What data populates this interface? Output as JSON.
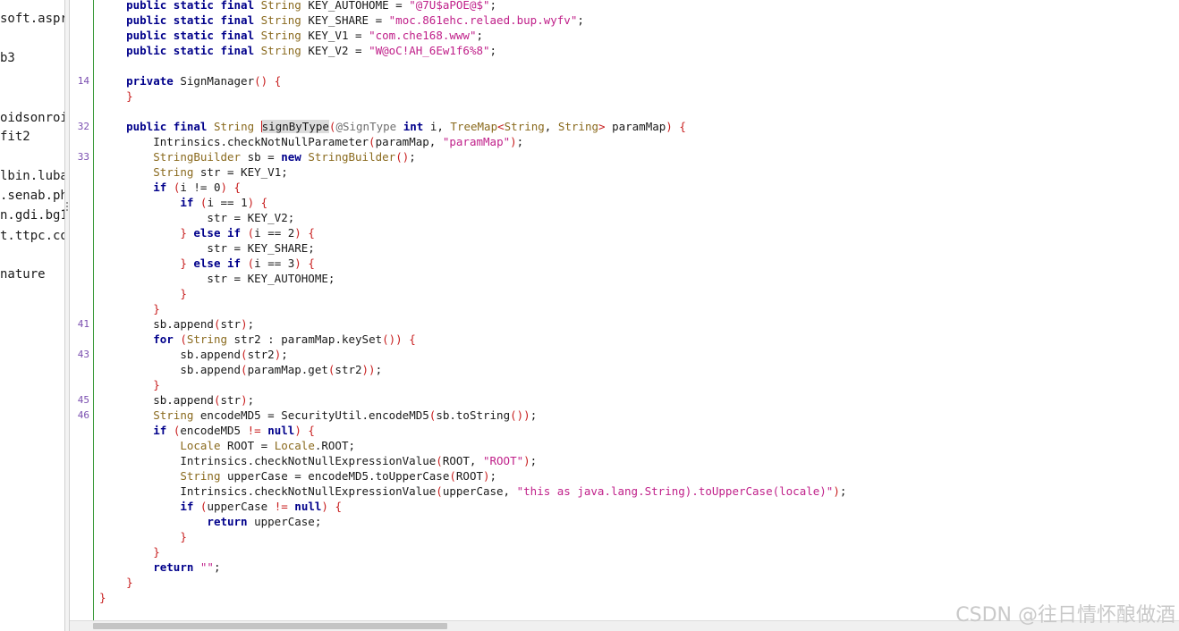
{
  "sidebar": {
    "items": [
      "soft.aspr",
      "b3",
      "oidsonroi",
      "fit2",
      "lbin.luba",
      ".senab.ph",
      "n.gdi.bg1",
      "t.ttpc.co",
      "nature"
    ]
  },
  "editor": {
    "line_numbers": [
      "14",
      "32",
      "33",
      "41",
      "43",
      "45",
      "46"
    ],
    "selected_word": "signByType",
    "code": {
      "kw": "public static final",
      "kw_private": "private",
      "kw_public": "public",
      "kw_final": "final",
      "kw_int": "int",
      "kw_new": "new",
      "kw_if": "if",
      "kw_else": "else",
      "kw_for": "for",
      "kw_null": "null",
      "kw_return": "return",
      "t_string": "String",
      "t_treemap": "TreeMap",
      "t_sb": "StringBuilder",
      "t_locale": "Locale",
      "n1": "KEY_AUTOHOME",
      "s1": "\"@7U$aPOE@$\"",
      "n2": "KEY_SHARE",
      "s2": "\"moc.861ehc.relaed.bup.wyfv\"",
      "n3": "KEY_V1",
      "s3": "\"com.che168.www\"",
      "n4": "KEY_V2",
      "s4": "\"W@oC!AH_6Ew1f6%8\"",
      "ctor": "SignManager",
      "ann": "@SignType",
      "i": "i",
      "paramMap": "paramMap",
      "check1": "Intrinsics.checkNotNullParameter",
      "s_paramMap": "\"paramMap\"",
      "sb_decl": "sb",
      "str_decl": "str = KEY_V1;",
      "cond0": "i != 0",
      "cond1": "i == 1",
      "cond2": "i == 2",
      "cond3": "i == 3",
      "asg_v2": "str = KEY_V2;",
      "asg_share": "str = KEY_SHARE;",
      "asg_auto": "str = KEY_AUTOHOME;",
      "sb_append": "sb.append",
      "str": "str",
      "str2": "str2",
      "keyset": "paramMap.keySet",
      "getmap": "paramMap.get",
      "encode_decl": "encodeMD5 = SecurityUtil.encodeMD5",
      "sbtostring": "sb.toString",
      "encodeMD5": "encodeMD5",
      "root_decl": "ROOT = ",
      "root_val": ".ROOT;",
      "check2": "Intrinsics.checkNotNullExpressionValue",
      "root_arg": "ROOT, ",
      "s_root": "\"ROOT\"",
      "upper_decl": "upperCase = encodeMD5.toUpperCase",
      "root_plain": "ROOT",
      "upper_arg": "upperCase, ",
      "s_upper": "\"this as java.lang.String).toUpperCase(locale)\"",
      "upperCase": "upperCase",
      "ret_upper": " upperCase;",
      "s_empty": "\"\""
    }
  },
  "watermark": "CSDN @往日情怀酿做酒"
}
